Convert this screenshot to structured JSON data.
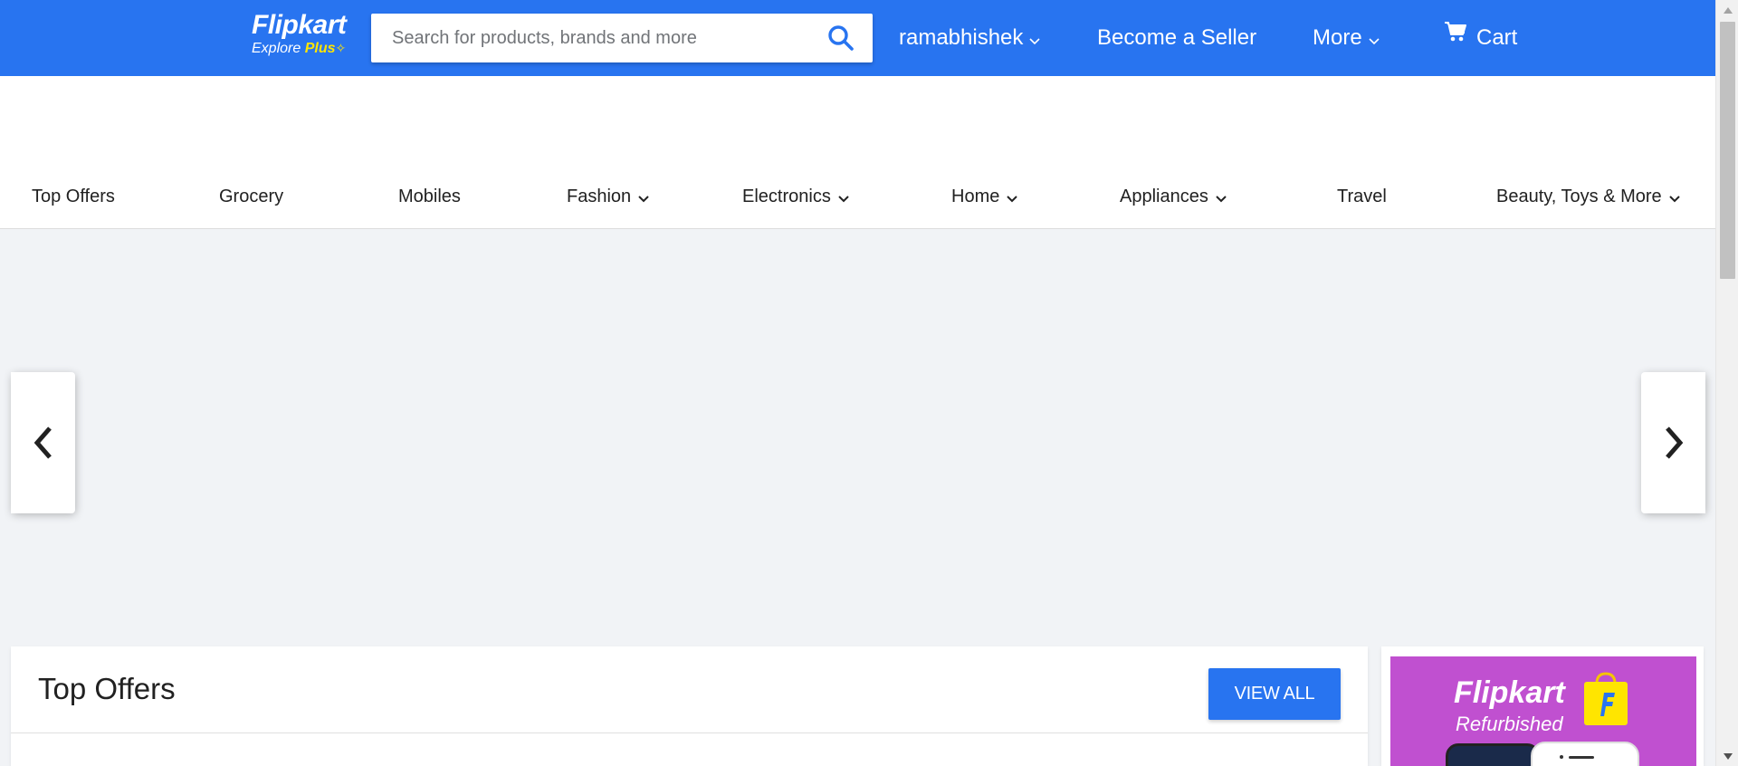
{
  "header": {
    "logo": {
      "brand": "Flipkart",
      "tagline": "Explore",
      "plus": "Plus",
      "star": "✧"
    },
    "search": {
      "placeholder": "Search for products, brands and more",
      "value": ""
    },
    "user": {
      "name": "ramabhishek"
    },
    "become_seller": "Become a Seller",
    "more": "More",
    "cart": "Cart"
  },
  "categories": [
    {
      "label": "Top Offers",
      "has_dropdown": false
    },
    {
      "label": "Grocery",
      "has_dropdown": false
    },
    {
      "label": "Mobiles",
      "has_dropdown": false
    },
    {
      "label": "Fashion",
      "has_dropdown": true
    },
    {
      "label": "Electronics",
      "has_dropdown": true
    },
    {
      "label": "Home",
      "has_dropdown": true
    },
    {
      "label": "Appliances",
      "has_dropdown": true
    },
    {
      "label": "Travel",
      "has_dropdown": false
    },
    {
      "label": "Beauty, Toys & More",
      "has_dropdown": true
    }
  ],
  "offers": {
    "title": "Top Offers",
    "view_all": "VIEW ALL"
  },
  "promo": {
    "brand": "Flipkart",
    "sub": "Refurbished"
  },
  "colors": {
    "primary": "#2874f0",
    "accent": "#ffe500",
    "page_bg": "#f1f3f6",
    "promo_bg": "#c050d0"
  },
  "icons": {
    "search": "search-icon",
    "cart": "cart-icon",
    "chevron": "chevron-down-icon",
    "prev": "chevron-left-icon",
    "next": "chevron-right-icon"
  }
}
